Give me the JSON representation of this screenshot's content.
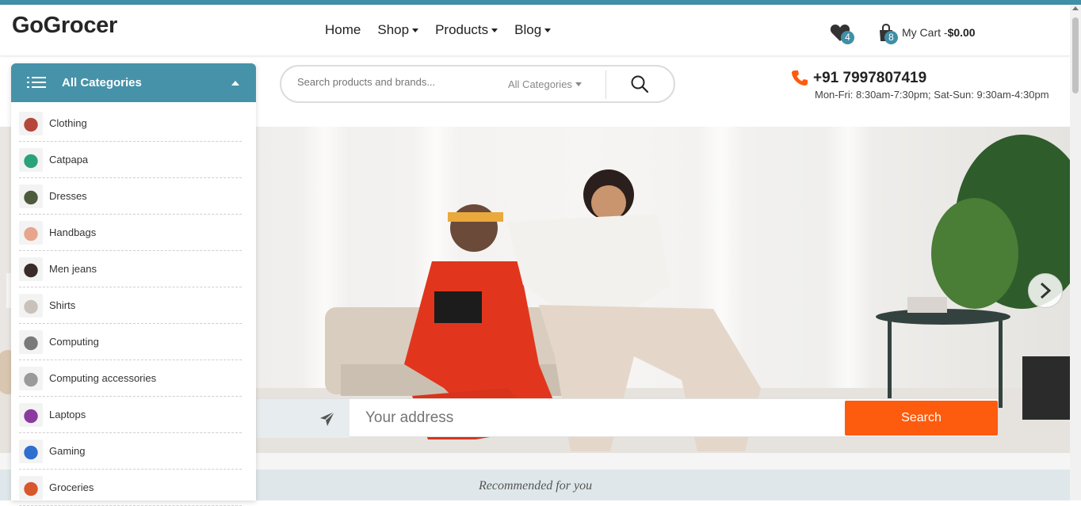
{
  "header": {
    "logo": "GoGrocer",
    "nav": [
      {
        "label": "Home",
        "dropdown": false
      },
      {
        "label": "Shop",
        "dropdown": true
      },
      {
        "label": "Products",
        "dropdown": true
      },
      {
        "label": "Blog",
        "dropdown": true
      }
    ],
    "wishlist_count": "4",
    "cart_count": "8",
    "cart_label": "My Cart -",
    "cart_total": "$0.00"
  },
  "categories": {
    "title": "All Categories",
    "items": [
      {
        "label": "Clothing",
        "icon": "clothing-thumb",
        "color": "#b5473a"
      },
      {
        "label": "Catpapa",
        "icon": "catpapa-thumb",
        "color": "#2aa37d"
      },
      {
        "label": "Dresses",
        "icon": "dresses-thumb",
        "color": "#4d5b3c"
      },
      {
        "label": "Handbags",
        "icon": "handbags-thumb",
        "color": "#e6a58c"
      },
      {
        "label": "Men jeans",
        "icon": "jeans-thumb",
        "color": "#3a2b2b"
      },
      {
        "label": "Shirts",
        "icon": "shirts-thumb",
        "color": "#c9c2bb"
      },
      {
        "label": "Computing",
        "icon": "computing-thumb",
        "color": "#7a7a7a"
      },
      {
        "label": "Computing accessories",
        "icon": "accessories-thumb",
        "color": "#9a9a9a"
      },
      {
        "label": "Laptops",
        "icon": "laptops-thumb",
        "color": "#8b3aa0"
      },
      {
        "label": "Gaming",
        "icon": "gaming-thumb",
        "color": "#2e6fd0"
      },
      {
        "label": "Groceries",
        "icon": "groceries-thumb",
        "color": "#d8572b"
      }
    ]
  },
  "search": {
    "placeholder": "Search products and brands...",
    "category": "All Categories"
  },
  "contact": {
    "phone": "+91 7997807419",
    "hours": "Mon-Fri: 8:30am-7:30pm; Sat-Sun: 9:30am-4:30pm"
  },
  "address": {
    "placeholder": "Your address",
    "button": "Search"
  },
  "recommended": {
    "title": "Recommended for you"
  },
  "colors": {
    "accent": "#4692a9",
    "cta": "#fd5b0d",
    "phone": "#fd5b0d"
  }
}
